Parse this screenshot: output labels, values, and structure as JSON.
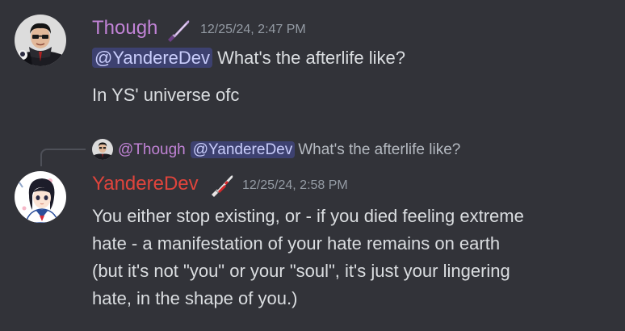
{
  "messages": [
    {
      "author": "Though",
      "author_color": "#c183d6",
      "timestamp": "12/25/24, 2:47 PM",
      "lines": [
        {
          "mention": "@YandereDev",
          "text": " What's the afterlife like?"
        },
        {
          "text": "In YS' universe ofc"
        }
      ]
    },
    {
      "author": "YandereDev",
      "author_color": "#e0443c",
      "timestamp": "12/25/24, 2:58 PM",
      "reply": {
        "author": "@Though",
        "mention": "@YandereDev",
        "text": "What's the afterlife like?"
      },
      "lines": [
        {
          "text": "You either stop existing, or - if you died feeling extreme"
        },
        {
          "text": "hate - a manifestation of your hate remains on earth"
        },
        {
          "text": "(but it's not \"you\" or your \"soul\", it's just your lingering"
        },
        {
          "text": "hate, in the shape of you.)"
        }
      ]
    }
  ],
  "icons": {
    "avatar_though": "avatar-though-icon",
    "role_though": "purple-knife-icon",
    "avatar_yandere": "avatar-yandere-icon",
    "role_yandere": "red-knife-icon",
    "reply_avatar": "avatar-though-small-icon"
  }
}
